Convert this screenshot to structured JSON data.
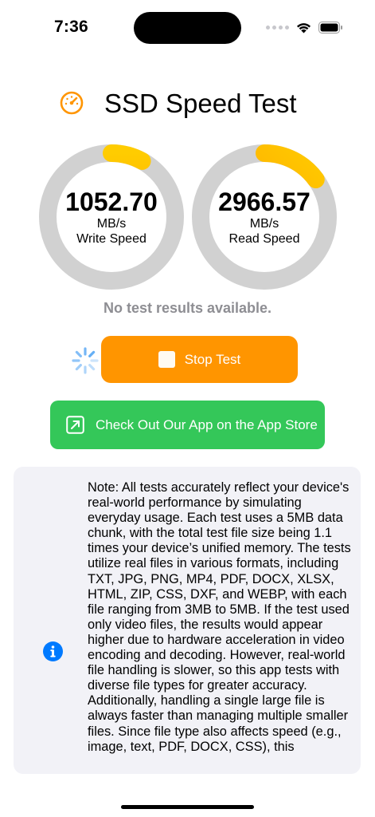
{
  "status_bar": {
    "time": "7:36"
  },
  "header": {
    "title": "SSD Speed Test",
    "icon": "speedometer-icon"
  },
  "gauges": {
    "write": {
      "value": "1052.70",
      "unit": "MB/s",
      "label": "Write Speed",
      "progress": 0.08
    },
    "read": {
      "value": "2966.57",
      "unit": "MB/s",
      "label": "Read Speed",
      "progress": 0.15
    }
  },
  "status_message": "No test results available.",
  "controls": {
    "stop_label": "Stop Test",
    "appstore_label": "Check Out Our App on the App Store"
  },
  "note": {
    "text": "Note: All tests accurately reflect your device's real-world performance by simulating everyday usage. Each test uses a 5MB data chunk, with the total test file size being 1.1 times your device’s unified memory. The tests utilize real files in various formats, including TXT, JPG, PNG, MP4, PDF, DOCX, XLSX, HTML, ZIP, CSS, DXF, and WEBP, with each file ranging from 3MB to 5MB. If the test used only video files, the results would appear higher due to hardware acceleration in video encoding and decoding. However, real-world file handling is slower, so this app tests with diverse file types for greater accuracy. Additionally, handling a single large file is always faster than managing multiple smaller files. Since file type also affects speed (e.g., image, text, PDF, DOCX, CSS), this"
  },
  "colors": {
    "accent_orange": "#ff9500",
    "gauge_track": "#d1d1d1",
    "gauge_progress_start": "#ff9500",
    "gauge_progress_end": "#ffcc00",
    "appstore_green": "#34c759",
    "info_blue": "#007aff",
    "card_bg": "#f2f2f7"
  }
}
